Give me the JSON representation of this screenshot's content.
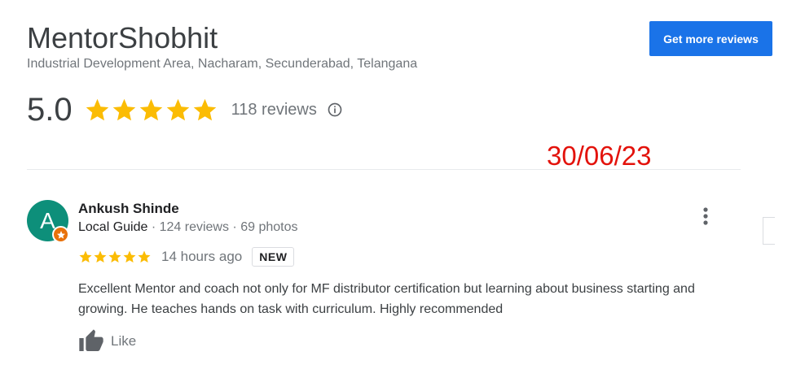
{
  "business": {
    "name": "MentorShobhit",
    "address": "Industrial Development Area, Nacharam, Secunderabad, Telangana",
    "rating": "5.0",
    "stars": 5,
    "review_count": "118 reviews"
  },
  "actions": {
    "get_more_reviews_label": "Get more reviews"
  },
  "annotation": {
    "date": "30/06/23",
    "color": "#e3120b"
  },
  "review": {
    "avatar_letter": "A",
    "avatar_color": "#0d8f7a",
    "reviewer_name": "Ankush Shinde",
    "guide_label": "Local Guide",
    "meta_rest": " · 124 reviews · 69 photos",
    "stars": 5,
    "time": "14 hours ago",
    "badge": "NEW",
    "text": "Excellent Mentor and coach not only for MF distributor certification but learning about business starting and growing. He teaches hands on task with curriculum. Highly recommended",
    "like_label": "Like"
  },
  "colors": {
    "star": "#fbbc04",
    "accent": "#1a73e8"
  },
  "icons": [
    "star-icon",
    "info-icon",
    "more-vert-icon",
    "thumbs-up-icon",
    "local-guide-badge-icon"
  ]
}
